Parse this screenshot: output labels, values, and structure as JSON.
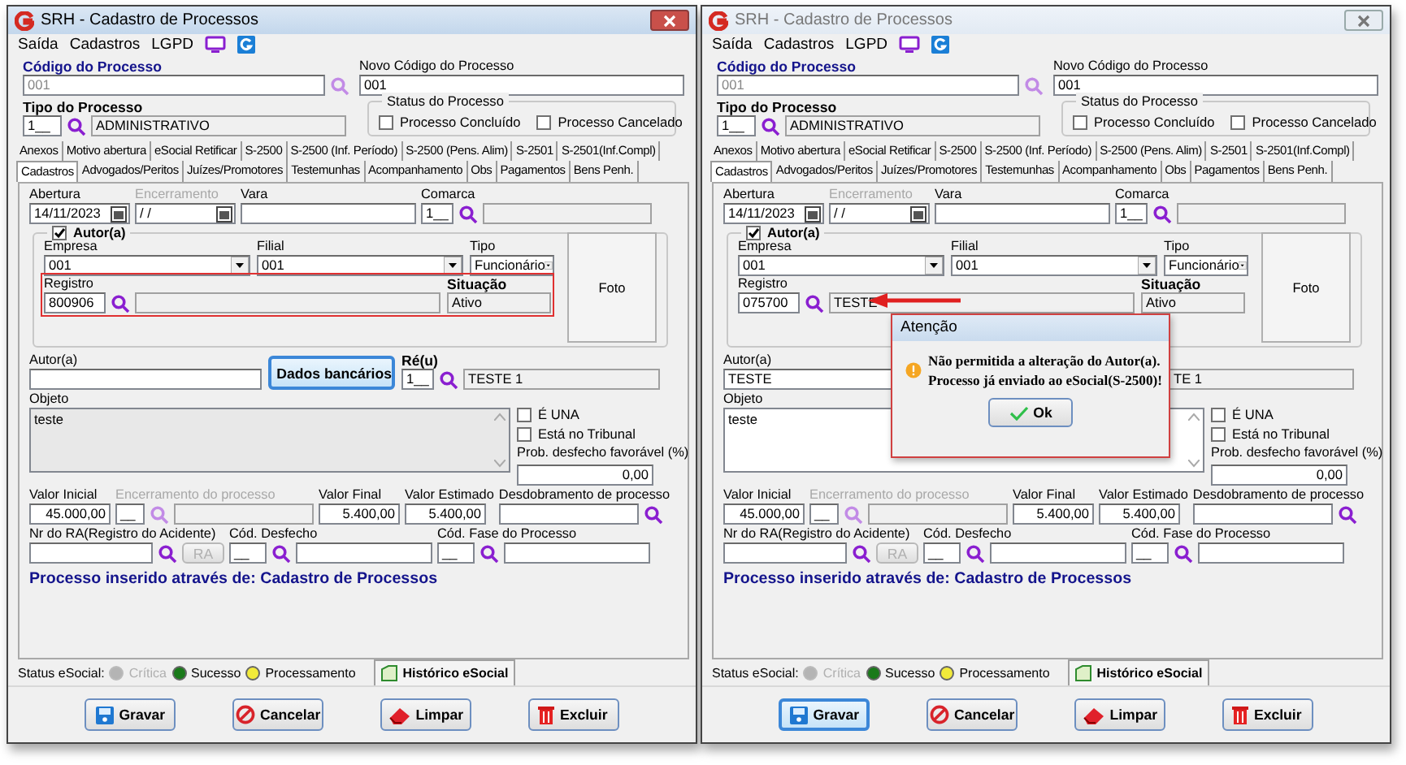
{
  "windows": [
    {
      "title": "SRH - Cadastro de Processos",
      "active": true,
      "menu": [
        "Saída",
        "Cadastros",
        "LGPD"
      ],
      "codigo": {
        "label": "Código do Processo",
        "value": "001"
      },
      "novo_codigo": {
        "label": "Novo Código do Processo",
        "value": "001"
      },
      "tipo": {
        "label": "Tipo do Processo",
        "code": "1__",
        "name": "ADMINISTRATIVO"
      },
      "status_processo": {
        "title": "Status do Processo",
        "options": [
          {
            "label": "Processo Concluído",
            "checked": false
          },
          {
            "label": "Processo Cancelado",
            "checked": false
          }
        ]
      },
      "tabs_row_1": [
        {
          "label": "Anexos",
          "selected": false
        },
        {
          "label": "Motivo abertura",
          "selected": false
        },
        {
          "label": "eSocial Retificar",
          "selected": false
        },
        {
          "label": "S-2500",
          "selected": false
        },
        {
          "label": "S-2500 (Inf. Período)",
          "selected": false
        },
        {
          "label": "S-2500 (Pens. Alim)",
          "selected": false
        },
        {
          "label": "S-2501",
          "selected": false
        },
        {
          "label": "S-2501(Inf.Compl)",
          "selected": false
        }
      ],
      "tabs_row_2": [
        {
          "label": "Cadastros",
          "selected": true
        },
        {
          "label": "Advogados/Peritos",
          "selected": false
        },
        {
          "label": "Juízes/Promotores",
          "selected": false
        },
        {
          "label": "Testemunhas",
          "selected": false
        },
        {
          "label": "Acompanhamento",
          "selected": false
        },
        {
          "label": "Obs",
          "selected": false
        },
        {
          "label": "Pagamentos",
          "selected": false
        },
        {
          "label": "Bens Penh.",
          "selected": false
        }
      ],
      "abertura": {
        "label": "Abertura",
        "value": "14/11/2023"
      },
      "encerramento": {
        "label": "Encerramento",
        "value": "/ /",
        "disabled": true
      },
      "vara": {
        "label": "Vara"
      },
      "comarca": {
        "label": "Comarca",
        "code": "1__"
      },
      "autor_group": {
        "title": "Autor(a)",
        "checked": true,
        "empresa": {
          "label": "Empresa",
          "value": "001"
        },
        "filial": {
          "label": "Filial",
          "value": "001"
        },
        "tipo": {
          "label": "Tipo",
          "value": "Funcionário"
        },
        "registro": {
          "label": "Registro",
          "code": "800906",
          "highlighted": true
        },
        "situacao": {
          "label": "Situação",
          "value": "Ativo"
        },
        "foto": "Foto"
      },
      "autor": {
        "label": "Autor(a)"
      },
      "dados_bancarios": {
        "label": "Dados bancários",
        "focused": true
      },
      "reu": {
        "label": "Ré(u)",
        "code": "1__",
        "name": "TESTE 1"
      },
      "objeto": {
        "label": "Objeto",
        "value": "teste"
      },
      "flags": [
        {
          "label": "É UNA",
          "checked": false
        },
        {
          "label": "Está no Tribunal",
          "checked": false
        }
      ],
      "prob": {
        "label": "Prob. desfecho favorável (%)",
        "value": "0,00"
      },
      "valor_inicial": {
        "label": "Valor Inicial",
        "value": "45.000,00"
      },
      "encerramento_processo": {
        "label": "Encerramento do processo",
        "code": "__",
        "disabled": true
      },
      "valor_final": {
        "label": "Valor Final",
        "value": "5.400,00"
      },
      "valor_estimado": {
        "label": "Valor Estimado",
        "value": "5.400,00"
      },
      "desdobramento": {
        "label": "Desdobramento de processo"
      },
      "nr_ra": {
        "label": "Nr do RA(Registro do Acidente)"
      },
      "ra_button": {
        "label": "RA",
        "disabled": true
      },
      "cod_desfecho": {
        "label": "Cód. Desfecho",
        "code": "__"
      },
      "cod_fase": {
        "label": "Cód. Fase do Processo",
        "code": "__"
      },
      "origin_note": "Processo inserido através de: Cadastro de Processos",
      "status_esocial": {
        "label": "Status eSocial:",
        "items": [
          {
            "label": "Crítica",
            "color": "#b4b4b4",
            "disabled": true
          },
          {
            "label": "Sucesso",
            "color": "#1a7a1a",
            "disabled": false
          },
          {
            "label": "Processamento",
            "color": "#f2ea3a",
            "disabled": false
          }
        ],
        "history_tab": "Histórico eSocial"
      },
      "buttons": [
        {
          "kind": "save",
          "label": "Gravar",
          "focused": false
        },
        {
          "kind": "cancel",
          "label": "Cancelar",
          "focused": false
        },
        {
          "kind": "clear",
          "label": "Limpar",
          "focused": false
        },
        {
          "kind": "delete",
          "label": "Excluir",
          "focused": false
        }
      ]
    },
    {
      "title": "SRH - Cadastro de Processos",
      "active": false,
      "menu": [
        "Saída",
        "Cadastros",
        "LGPD"
      ],
      "codigo": {
        "label": "Código do Processo",
        "value": "001"
      },
      "novo_codigo": {
        "label": "Novo Código do Processo",
        "value": "001"
      },
      "tipo": {
        "label": "Tipo do Processo",
        "code": "1__",
        "name": "ADMINISTRATIVO"
      },
      "status_processo": {
        "title": "Status do Processo",
        "options": [
          {
            "label": "Processo Concluído",
            "checked": false
          },
          {
            "label": "Processo Cancelado",
            "checked": false
          }
        ]
      },
      "tabs_row_1": [
        {
          "label": "Anexos",
          "selected": false
        },
        {
          "label": "Motivo abertura",
          "selected": false
        },
        {
          "label": "eSocial Retificar",
          "selected": false
        },
        {
          "label": "S-2500",
          "selected": false
        },
        {
          "label": "S-2500 (Inf. Período)",
          "selected": false
        },
        {
          "label": "S-2500 (Pens. Alim)",
          "selected": false
        },
        {
          "label": "S-2501",
          "selected": false
        },
        {
          "label": "S-2501(Inf.Compl)",
          "selected": false
        }
      ],
      "tabs_row_2": [
        {
          "label": "Cadastros",
          "selected": true
        },
        {
          "label": "Advogados/Peritos",
          "selected": false
        },
        {
          "label": "Juízes/Promotores",
          "selected": false
        },
        {
          "label": "Testemunhas",
          "selected": false
        },
        {
          "label": "Acompanhamento",
          "selected": false
        },
        {
          "label": "Obs",
          "selected": false
        },
        {
          "label": "Pagamentos",
          "selected": false
        },
        {
          "label": "Bens Penh.",
          "selected": false
        }
      ],
      "abertura": {
        "label": "Abertura",
        "value": "14/11/2023"
      },
      "encerramento": {
        "label": "Encerramento",
        "value": "/ /",
        "disabled": true
      },
      "vara": {
        "label": "Vara"
      },
      "comarca": {
        "label": "Comarca",
        "code": "1__"
      },
      "autor_group": {
        "title": "Autor(a)",
        "checked": true,
        "empresa": {
          "label": "Empresa",
          "value": "001"
        },
        "filial": {
          "label": "Filial",
          "value": "001"
        },
        "tipo": {
          "label": "Tipo",
          "value": "Funcionário"
        },
        "registro": {
          "label": "Registro",
          "code": "075700",
          "name": "TESTE",
          "highlighted": false
        },
        "situacao": {
          "label": "Situação",
          "value": "Ativo"
        },
        "foto": "Foto"
      },
      "autor": {
        "label": "Autor(a)",
        "value": "TESTE"
      },
      "reu": {
        "name": "TE 1"
      },
      "objeto": {
        "label": "Objeto",
        "value": "teste"
      },
      "flags": [
        {
          "label": "É UNA",
          "checked": false
        },
        {
          "label": "Está no Tribunal",
          "checked": false
        }
      ],
      "prob": {
        "label": "Prob. desfecho favorável (%)",
        "value": "0,00"
      },
      "valor_inicial": {
        "label": "Valor Inicial",
        "value": "45.000,00"
      },
      "encerramento_processo": {
        "label": "Encerramento do processo",
        "code": "__",
        "disabled": true
      },
      "valor_final": {
        "label": "Valor Final",
        "value": "5.400,00"
      },
      "valor_estimado": {
        "label": "Valor Estimado",
        "value": "5.400,00"
      },
      "desdobramento": {
        "label": "Desdobramento de processo"
      },
      "nr_ra": {
        "label": "Nr do RA(Registro do Acidente)"
      },
      "ra_button": {
        "label": "RA",
        "disabled": true
      },
      "cod_desfecho": {
        "label": "Cód. Desfecho",
        "code": "__"
      },
      "cod_fase": {
        "label": "Cód. Fase do Processo",
        "code": "__"
      },
      "origin_note": "Processo inserido através de: Cadastro de Processos",
      "status_esocial": {
        "label": "Status eSocial:",
        "items": [
          {
            "label": "Crítica",
            "color": "#b4b4b4",
            "disabled": true
          },
          {
            "label": "Sucesso",
            "color": "#1a7a1a",
            "disabled": false
          },
          {
            "label": "Processamento",
            "color": "#f2ea3a",
            "disabled": false
          }
        ],
        "history_tab": "Histórico eSocial"
      },
      "buttons": [
        {
          "kind": "save",
          "label": "Gravar",
          "focused": true
        },
        {
          "kind": "cancel",
          "label": "Cancelar",
          "focused": false
        },
        {
          "kind": "clear",
          "label": "Limpar",
          "focused": false
        },
        {
          "kind": "delete",
          "label": "Excluir",
          "focused": false
        }
      ],
      "pointer_arrow": true,
      "dialog": {
        "title": "Atenção",
        "message": "Não permitida a alteração do Autor(a).\nProcesso já enviado ao eSocial(S-2500)!",
        "button": "Ok"
      }
    }
  ]
}
